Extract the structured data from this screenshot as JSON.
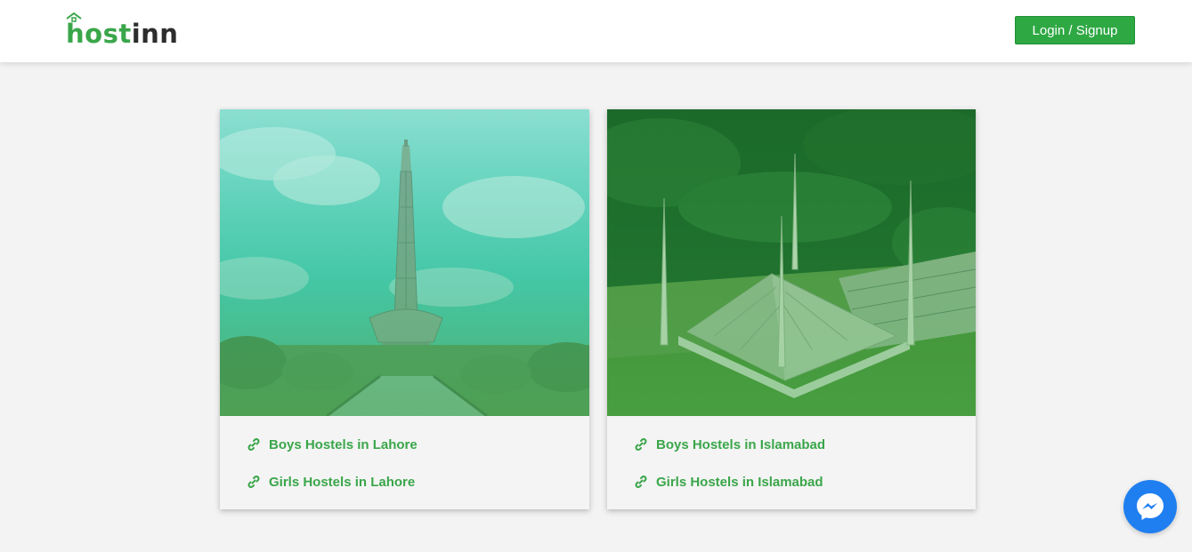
{
  "header": {
    "logo": {
      "part1": "host",
      "part2": "inn"
    },
    "login_label": "Login / Signup"
  },
  "cards": [
    {
      "image_icon": "minar-e-pakistan-photo",
      "links": [
        {
          "label": "Boys Hostels in Lahore",
          "icon": "link-icon"
        },
        {
          "label": "Girls Hostels in Lahore",
          "icon": "link-icon"
        }
      ]
    },
    {
      "image_icon": "faisal-mosque-photo",
      "links": [
        {
          "label": "Boys Hostels in Islamabad",
          "icon": "link-icon"
        },
        {
          "label": "Girls Hostels in Islamabad",
          "icon": "link-icon"
        }
      ]
    }
  ],
  "messenger": {
    "icon": "messenger-icon"
  },
  "colors": {
    "brand_green": "#3aa64a",
    "button_green": "#2ea843",
    "messenger_blue": "#1f7ff0",
    "background": "#f3f3f3"
  }
}
